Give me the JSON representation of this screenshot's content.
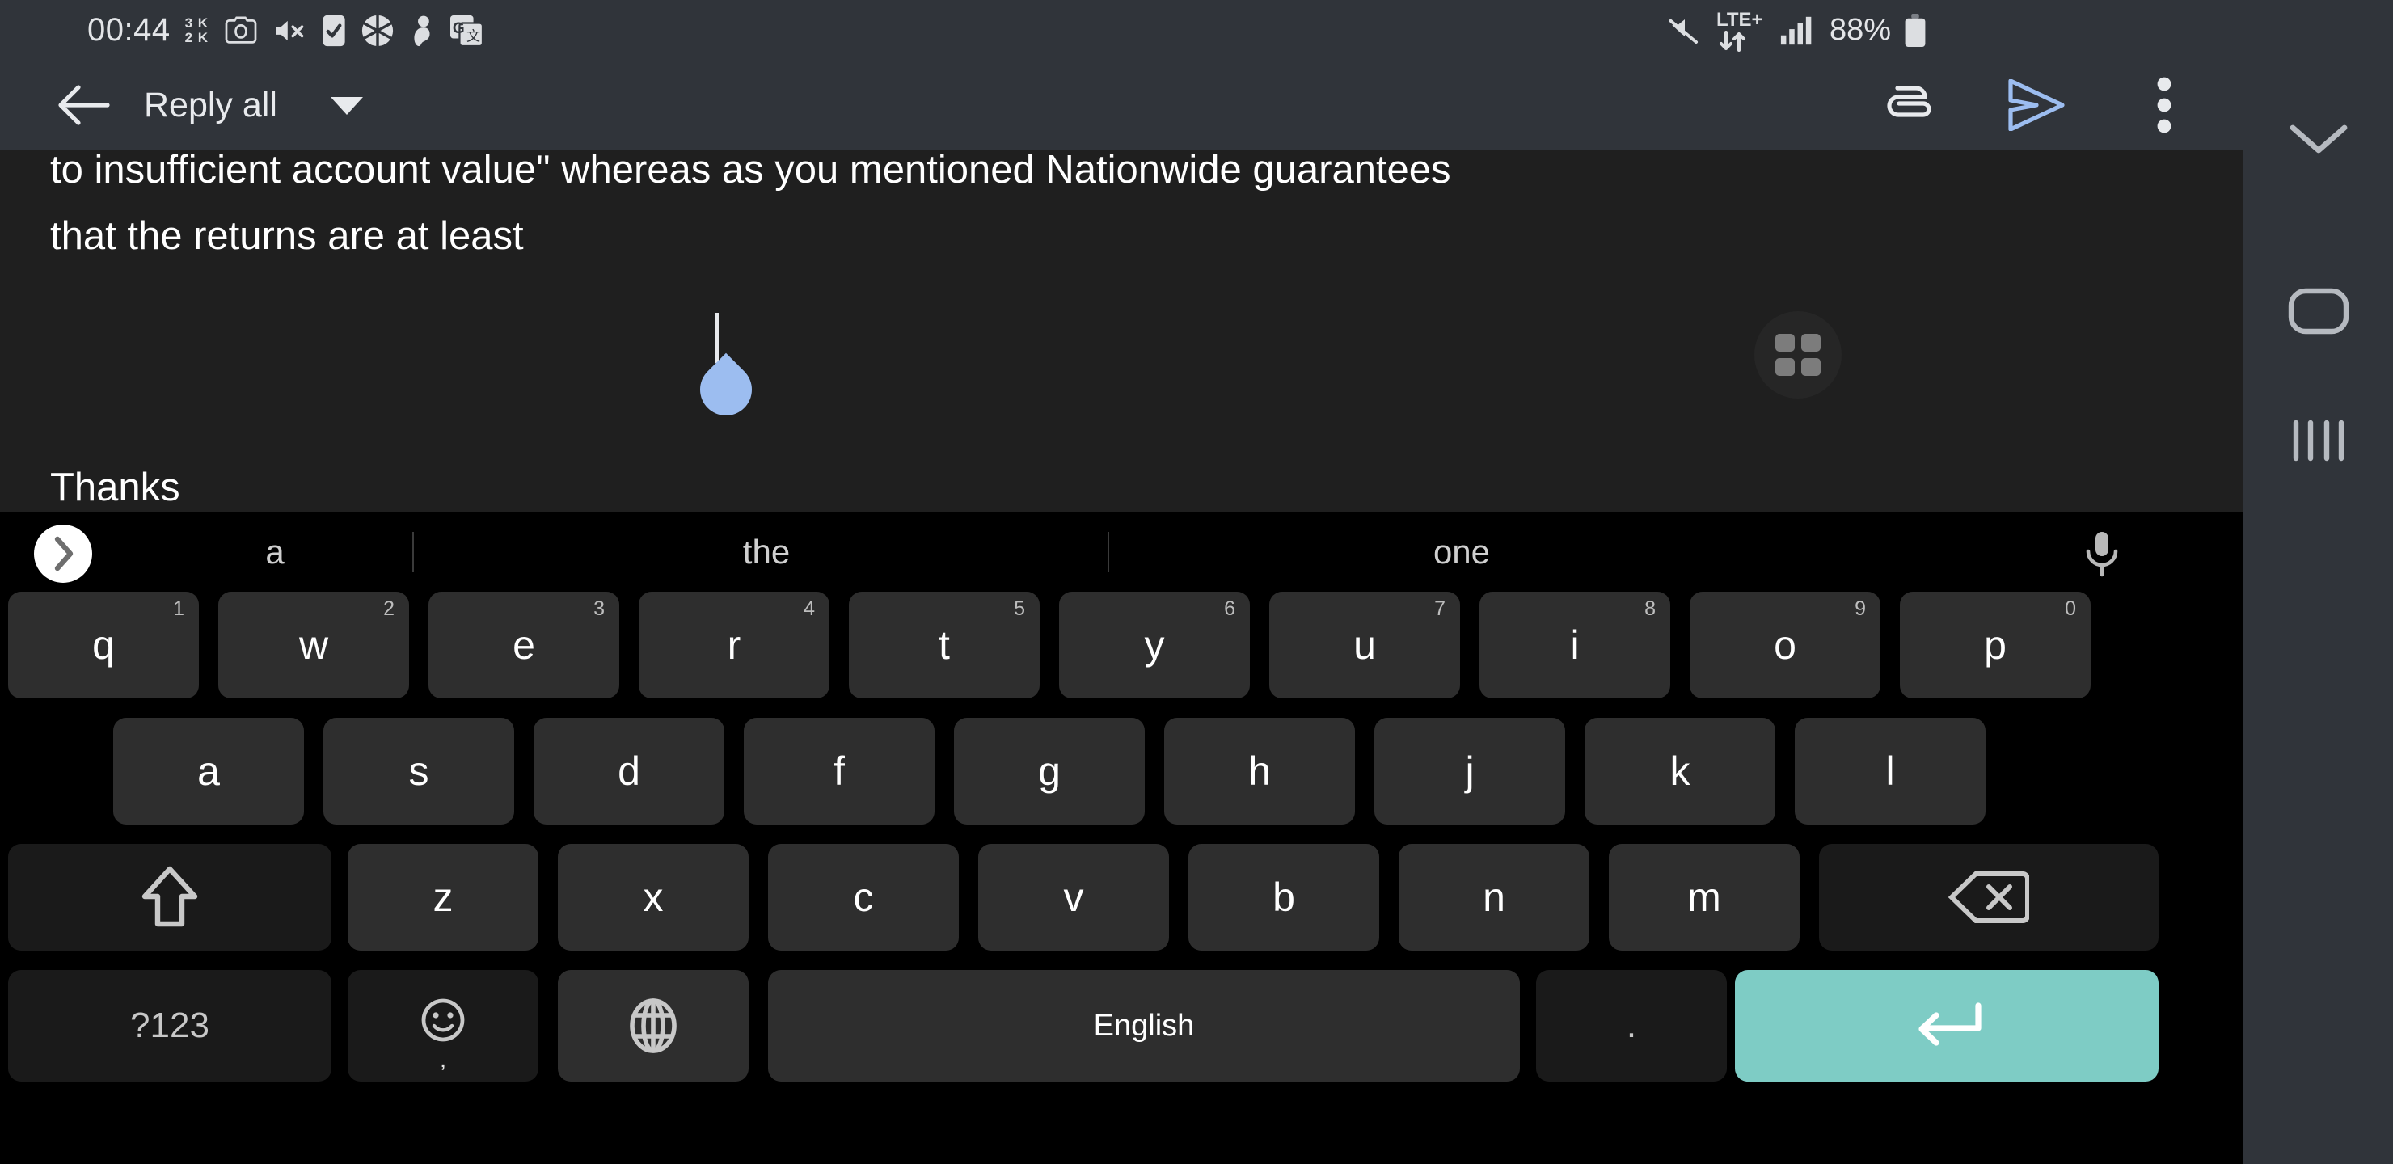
{
  "statusbar": {
    "time": "00:44",
    "resolution_badge_top": "3 K",
    "resolution_badge_bottom": "2 K",
    "icons_left": [
      "camera-icon",
      "volume-mute-icon",
      "checkbox-checked-icon",
      "aperture-icon",
      "person-icon",
      "google-translate-icon"
    ],
    "network_label": "LTE+",
    "icons_right": [
      "notifications-muted-icon",
      "data-transfer-icon",
      "signal-bars-icon",
      "battery-icon"
    ],
    "battery_percent": "88%"
  },
  "toolbar": {
    "back_icon": "back-arrow-icon",
    "reply_mode": "Reply all",
    "caret_icon": "chevron-down-icon",
    "attach_icon": "paperclip-icon",
    "send_icon": "send-icon",
    "overflow_icon": "more-vertical-icon",
    "send_color": "#9cbdf0"
  },
  "compose": {
    "body_text": "to insufficient account value\" whereas as you mentioned Nationwide guarantees\nthat the returns are at least ",
    "signature": "Thanks",
    "caret_visible": true,
    "selection_handle_color": "#9cbdf0",
    "grid_chip_icon": "grid-4-squares-icon"
  },
  "keyboard": {
    "expand_icon": "chevron-right-icon",
    "mic_icon": "microphone-icon",
    "suggestions": [
      "a",
      "the",
      "one"
    ],
    "row1": [
      {
        "label": "q",
        "sup": "1"
      },
      {
        "label": "w",
        "sup": "2"
      },
      {
        "label": "e",
        "sup": "3"
      },
      {
        "label": "r",
        "sup": "4"
      },
      {
        "label": "t",
        "sup": "5"
      },
      {
        "label": "y",
        "sup": "6"
      },
      {
        "label": "u",
        "sup": "7"
      },
      {
        "label": "i",
        "sup": "8"
      },
      {
        "label": "o",
        "sup": "9"
      },
      {
        "label": "p",
        "sup": "0"
      }
    ],
    "row2": [
      "a",
      "s",
      "d",
      "f",
      "g",
      "h",
      "j",
      "k",
      "l"
    ],
    "row3": [
      "z",
      "x",
      "c",
      "v",
      "b",
      "n",
      "m"
    ],
    "shift_icon": "shift-arrow-icon",
    "backspace_icon": "backspace-icon",
    "symbols_label": "?123",
    "emoji_icon": "emoji-smiley-icon",
    "emoji_sub_label": ",",
    "language_icon": "globe-icon",
    "space_label": "English",
    "period_label": ".",
    "enter_icon": "enter-arrow-icon",
    "enter_color": "#7eccc5"
  },
  "navbar": {
    "hide_keyboard_icon": "chevron-down-icon",
    "home_icon": "home-rounded-square-icon",
    "recents_icon": "recents-bars-icon"
  }
}
